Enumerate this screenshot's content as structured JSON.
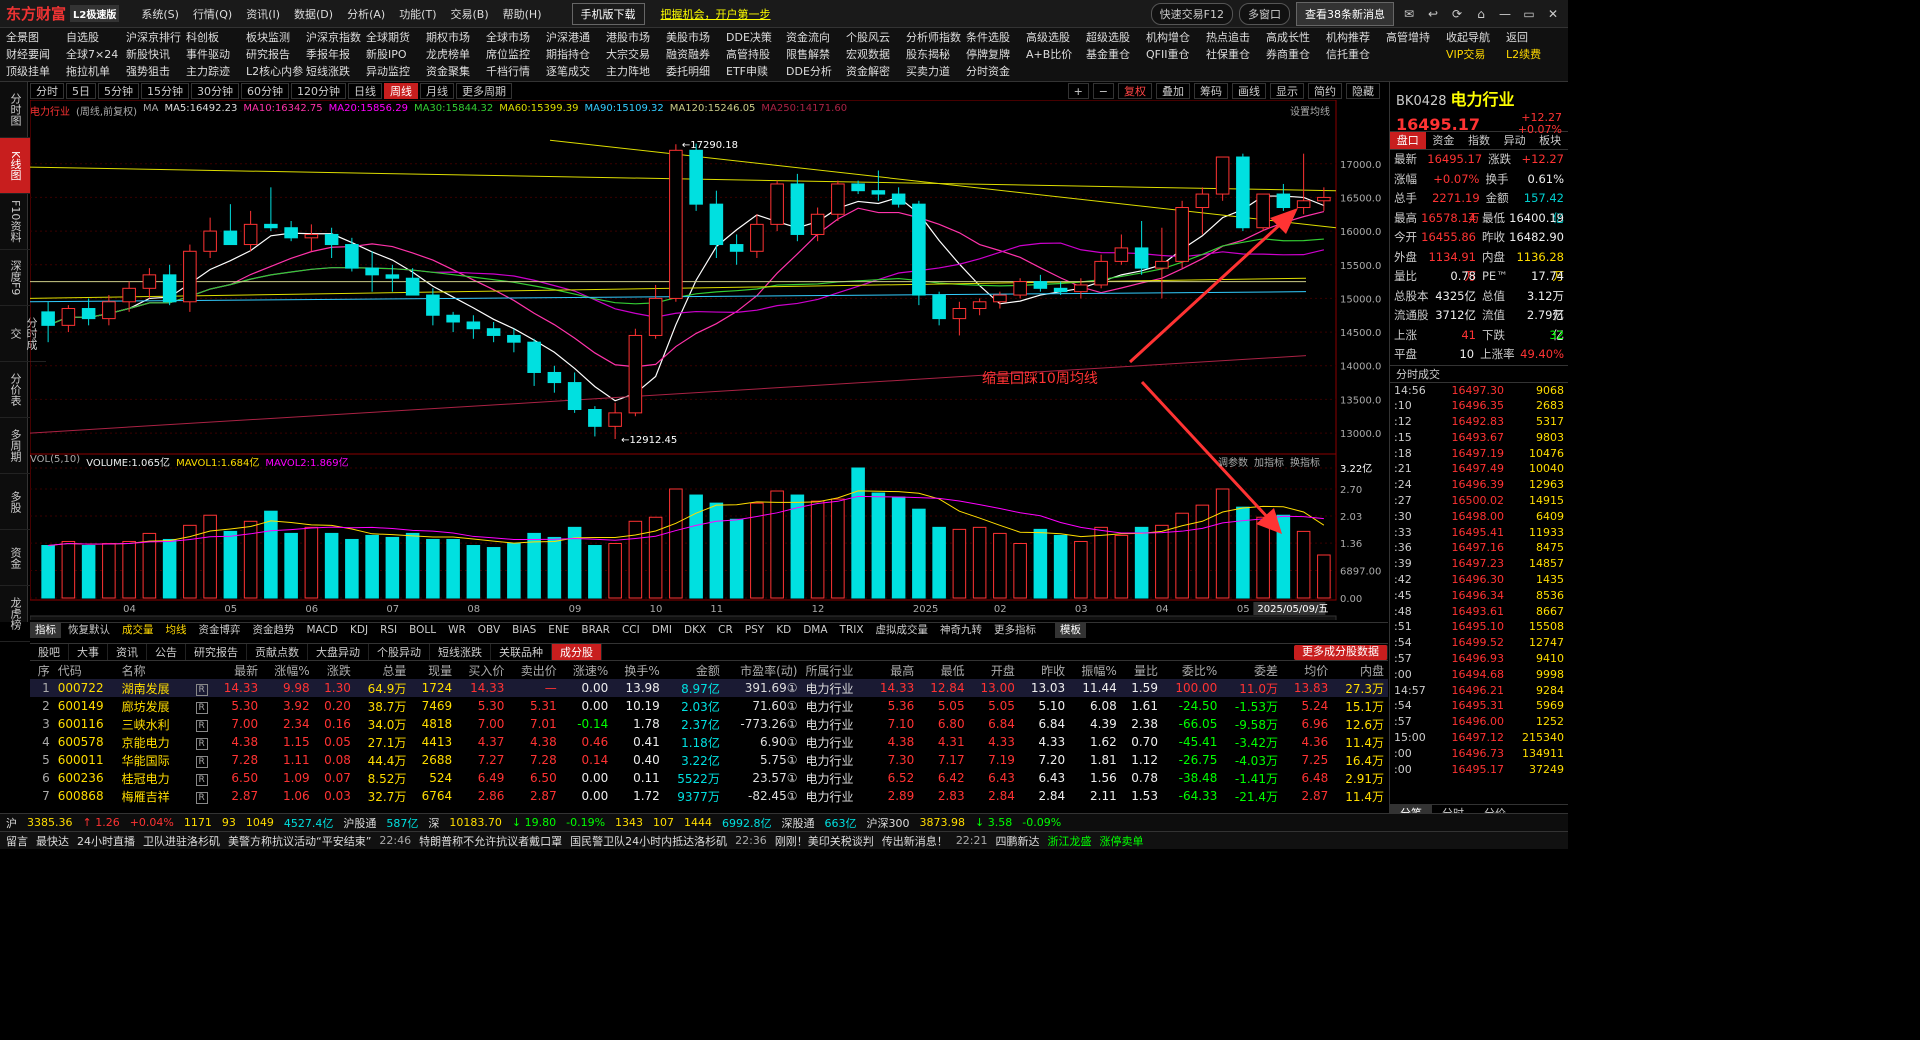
{
  "app": {
    "logo": "东方财富",
    "edition": "L2极速版"
  },
  "menu": [
    "系统(S)",
    "行情(Q)",
    "资讯(I)",
    "数据(D)",
    "分析(A)",
    "功能(T)",
    "交易(B)",
    "帮助(H)"
  ],
  "promo": {
    "mobile": "手机版下载",
    "opportunity": "把握机会，开户第一步"
  },
  "titlebar": {
    "search": "快速交易F12",
    "multi": "多窗口",
    "news": "查看38条新消息",
    "badge": "38"
  },
  "toolbar": [
    [
      "全景图",
      "自选股",
      "沪深京排行",
      "科创板",
      "板块监测",
      "沪深京指数",
      "全球期货",
      "期权市场",
      "全球市场",
      "沪深港通",
      "港股市场",
      "美股市场",
      "DDE决策",
      "资金流向",
      "个股风云",
      "分析师指数",
      "条件选股",
      "高级选股",
      "超级选股",
      "机构增仓",
      "热点追击",
      "高成长性",
      "机构推荐",
      "高管增持",
      "收起导航",
      "返回"
    ],
    [
      "财经要闻",
      "全球7×24",
      "新股快讯",
      "事件驱动",
      "研究报告",
      "季报年报",
      "新股IPO",
      "龙虎榜单",
      "席位监控",
      "期指持仓",
      "大宗交易",
      "融资融券",
      "高管持股",
      "限售解禁",
      "宏观数据",
      "股东揭秘",
      "停牌复牌",
      "A+B比价",
      "基金重仓",
      "QFII重仓",
      "社保重仓",
      "券商重仓",
      "信托重仓",
      "",
      "VIP交易",
      "L2续费"
    ],
    [
      "顶级挂单",
      "拖拉机单",
      "强势狙击",
      "主力踪迹",
      "L2核心内参",
      "短线涨跌",
      "异动监控",
      "资金聚集",
      "千档行情",
      "逐笔成交",
      "主力阵地",
      "委托明细",
      "ETF申赎",
      "DDE分析",
      "资金解密",
      "买卖力道",
      "分时资金",
      "",
      "",
      "",
      "",
      "",
      "",
      "",
      "",
      ""
    ]
  ],
  "leftnav": [
    "分时图",
    "K线图",
    "F10资料",
    "深度F9",
    "分时成交",
    "分价表",
    "多周期",
    "多股",
    "资金",
    "龙虎榜"
  ],
  "periods": [
    "分时",
    "5日",
    "5分钟",
    "15分钟",
    "30分钟",
    "60分钟",
    "120分钟",
    "日线",
    "周线",
    "月线",
    "更多周期"
  ],
  "period_active": "周线",
  "chart_tools": {
    "fq": "复权",
    "overlay": "叠加",
    "chips": "筹码",
    "draw": "画线",
    "display": "显示",
    "simple": "简约",
    "hide": "隐藏"
  },
  "ma_legend": {
    "name": "电力行业",
    "mode": "(周线,前复权)",
    "ma": "MA",
    "ma5": "MA5:16492.23",
    "ma10": "MA10:16342.75",
    "ma20": "MA20:15856.29",
    "ma30": "MA30:15844.32",
    "ma60": "MA60:15399.39",
    "ma90": "MA90:15109.32",
    "ma120": "MA120:15246.05",
    "ma250": "MA250:14171.60",
    "settings": "设置均线"
  },
  "vol_legend": {
    "title": "VOL(5,10)",
    "volume": "VOLUME:1.065亿",
    "mavol1": "MAVOL1:1.684亿",
    "mavol2": "MAVOL2:1.869亿",
    "params": "调参数",
    "add": "加指标",
    "switch": "换指标"
  },
  "annotation": "缩量回踩10周均线",
  "chart_data": {
    "type": "candlestick",
    "title": "电力行业",
    "price_ticks": [
      17000,
      16500,
      16000,
      15500,
      15000,
      14500,
      14000,
      13500,
      13000
    ],
    "price_ticks_text": [
      "17000.0",
      "16500.0",
      "16000.0",
      "15500.0",
      "15000.0",
      "14500.0",
      "14000.0",
      "13500.0",
      "13000.0"
    ],
    "ylim": [
      12600,
      17650
    ],
    "high_label": "17290.18",
    "low_label": "12912.45",
    "vol_ticks_text": [
      "3.22亿",
      "2.70",
      "2.03",
      "1.36",
      "6897.00",
      "0.00"
    ],
    "vol_max": 3.22,
    "x_labels": [
      "04",
      "05",
      "06",
      "07",
      "08",
      "09",
      "10",
      "11",
      "12",
      "2025",
      "02",
      "03",
      "04",
      "05",
      "06"
    ],
    "x_label_index": [
      4,
      9,
      13,
      17,
      21,
      26,
      30,
      33,
      38,
      43,
      47,
      51,
      55,
      59,
      61
    ],
    "date_tip": "2025/05/09/五",
    "candles": [
      [
        14800,
        14950,
        14350,
        14600
      ],
      [
        14600,
        14900,
        14500,
        14850
      ],
      [
        14850,
        15000,
        14600,
        14700
      ],
      [
        14700,
        15050,
        14600,
        14950
      ],
      [
        14950,
        15250,
        14800,
        15150
      ],
      [
        15150,
        15450,
        15000,
        15350
      ],
      [
        15350,
        15500,
        14900,
        14950
      ],
      [
        14950,
        15800,
        14800,
        15700
      ],
      [
        15700,
        16200,
        15600,
        16000
      ],
      [
        16000,
        16400,
        15800,
        15800
      ],
      [
        15800,
        16300,
        15700,
        16100
      ],
      [
        16100,
        16650,
        16000,
        16050
      ],
      [
        16050,
        16150,
        15850,
        15900
      ],
      [
        15900,
        16100,
        15700,
        15950
      ],
      [
        15950,
        16050,
        15600,
        15800
      ],
      [
        15800,
        15900,
        15400,
        15450
      ],
      [
        15450,
        15700,
        15100,
        15350
      ],
      [
        15350,
        15500,
        15100,
        15300
      ],
      [
        15300,
        15450,
        15050,
        15050
      ],
      [
        15050,
        15150,
        14600,
        14750
      ],
      [
        14750,
        14800,
        14500,
        14650
      ],
      [
        14650,
        14750,
        14400,
        14550
      ],
      [
        14550,
        14650,
        14350,
        14450
      ],
      [
        14450,
        14550,
        14200,
        14350
      ],
      [
        14350,
        14400,
        13700,
        13900
      ],
      [
        13900,
        14000,
        13600,
        13750
      ],
      [
        13750,
        13900,
        13300,
        13350
      ],
      [
        13350,
        13400,
        12950,
        13100
      ],
      [
        13100,
        13450,
        12912,
        13300
      ],
      [
        13300,
        14550,
        13250,
        14450
      ],
      [
        14450,
        15200,
        14400,
        15000
      ],
      [
        15000,
        17290,
        14950,
        17200
      ],
      [
        17200,
        17300,
        16300,
        16400
      ],
      [
        16400,
        16600,
        15600,
        15800
      ],
      [
        15800,
        15950,
        15500,
        15700
      ],
      [
        15700,
        16250,
        15600,
        16100
      ],
      [
        16100,
        16750,
        16000,
        16700
      ],
      [
        16700,
        16850,
        15850,
        15950
      ],
      [
        15950,
        16350,
        15850,
        16250
      ],
      [
        16250,
        16750,
        16150,
        16700
      ],
      [
        16700,
        16750,
        16550,
        16600
      ],
      [
        16600,
        16900,
        16450,
        16550
      ],
      [
        16550,
        16650,
        16350,
        16400
      ],
      [
        16400,
        16450,
        14900,
        15050
      ],
      [
        15050,
        15100,
        14600,
        14700
      ],
      [
        14700,
        14950,
        14450,
        14850
      ],
      [
        14850,
        15000,
        14750,
        14950
      ],
      [
        14950,
        15100,
        14850,
        15050
      ],
      [
        15050,
        15300,
        15000,
        15250
      ],
      [
        15250,
        15350,
        15100,
        15150
      ],
      [
        15150,
        15250,
        15050,
        15100
      ],
      [
        15100,
        15300,
        15000,
        15200
      ],
      [
        15200,
        15650,
        15150,
        15550
      ],
      [
        15550,
        15950,
        15500,
        15750
      ],
      [
        15750,
        16150,
        15350,
        15450
      ],
      [
        15450,
        16050,
        15000,
        15550
      ],
      [
        15550,
        16450,
        15450,
        16350
      ],
      [
        16350,
        16650,
        15950,
        16550
      ],
      [
        16550,
        16950,
        16450,
        17100
      ],
      [
        17100,
        17150,
        16000,
        16050
      ],
      [
        16050,
        16550,
        16000,
        16550
      ],
      [
        16550,
        16700,
        16300,
        16350
      ],
      [
        16350,
        17150,
        16250,
        16450
      ],
      [
        16450,
        16650,
        16300,
        16500
      ]
    ],
    "volumes": [
      1.3,
      1.4,
      1.3,
      1.35,
      1.4,
      1.6,
      1.45,
      1.8,
      2.05,
      1.65,
      1.9,
      2.15,
      1.6,
      1.75,
      1.6,
      1.45,
      1.55,
      1.5,
      1.6,
      1.45,
      1.45,
      1.3,
      1.25,
      1.35,
      1.6,
      1.5,
      1.75,
      1.3,
      1.35,
      1.9,
      2.0,
      2.7,
      2.55,
      2.35,
      1.95,
      2.35,
      2.65,
      2.55,
      2.4,
      2.45,
      3.22,
      2.6,
      2.5,
      2.2,
      1.75,
      1.7,
      1.75,
      1.6,
      1.35,
      1.7,
      1.55,
      1.4,
      1.75,
      1.55,
      1.75,
      1.8,
      2.1,
      2.3,
      2.7,
      2.25,
      2.0,
      2.05,
      1.65,
      1.065
    ]
  },
  "right": {
    "code": "BK0428",
    "name": "电力行业",
    "price": "16495.17",
    "chg": "+12.27",
    "pct": "+0.07%",
    "tabs": [
      "盘口",
      "资金",
      "指数",
      "异动",
      "板块"
    ],
    "quotes": [
      [
        "最新",
        "16495.17",
        "涨跌",
        "+12.27"
      ],
      [
        "涨幅",
        "+0.07%",
        "换手",
        "0.61%"
      ],
      [
        "总手",
        "2271.19万",
        "金额",
        "157.42亿"
      ],
      [
        "最高",
        "16578.14",
        "最低",
        "16400.19"
      ],
      [
        "今开",
        "16455.86",
        "昨收",
        "16482.90"
      ],
      [
        "外盘",
        "1134.91万",
        "内盘",
        "1136.28万"
      ],
      [
        "量比",
        "0.78",
        "PE™",
        "17.74"
      ],
      [
        "总股本",
        "4325亿",
        "总值",
        "3.12万亿"
      ],
      [
        "流通股",
        "3712亿",
        "流值",
        "2.79万亿"
      ],
      [
        "上涨",
        "41",
        "下跌",
        "32"
      ],
      [
        "平盘",
        "10",
        "上涨率",
        "49.40%"
      ]
    ],
    "ticks_title": "分时成交",
    "ticks": [
      [
        "14:56",
        "16497.30",
        "9068",
        "g"
      ],
      [
        ":10",
        "16496.35",
        "2683",
        "r"
      ],
      [
        ":12",
        "16492.83",
        "5317",
        "r"
      ],
      [
        ":15",
        "16493.67",
        "9803",
        "r"
      ],
      [
        ":18",
        "16497.19",
        "10476",
        "r"
      ],
      [
        ":21",
        "16497.49",
        "10040",
        "r"
      ],
      [
        ":24",
        "16496.39",
        "12963",
        "r"
      ],
      [
        ":27",
        "16500.02",
        "14915",
        "r"
      ],
      [
        ":30",
        "16498.00",
        "6409",
        "r"
      ],
      [
        ":33",
        "16495.41",
        "11933",
        "r"
      ],
      [
        ":36",
        "16497.16",
        "8475",
        "r"
      ],
      [
        ":39",
        "16497.23",
        "14857",
        "r"
      ],
      [
        ":42",
        "16496.30",
        "1435",
        "r"
      ],
      [
        ":45",
        "16496.34",
        "8536",
        "r"
      ],
      [
        ":48",
        "16493.61",
        "8667",
        "r"
      ],
      [
        ":51",
        "16495.10",
        "15508",
        "r"
      ],
      [
        ":54",
        "16499.52",
        "12747",
        "r"
      ],
      [
        ":57",
        "16496.93",
        "9410",
        "r"
      ],
      [
        ":00",
        "16494.68",
        "9998",
        "r"
      ],
      [
        "14:57",
        "16496.21",
        "9284",
        "r"
      ],
      [
        ":54",
        "16495.31",
        "5969",
        "r"
      ],
      [
        ":57",
        "16496.00",
        "1252",
        "r"
      ],
      [
        "15:00",
        "16497.12",
        "215340",
        "r"
      ],
      [
        ":00",
        "16496.73",
        "134911",
        "r"
      ],
      [
        ":00",
        "16495.17",
        "37249",
        "r"
      ]
    ],
    "btabs": [
      "分笔",
      "分时",
      "分价"
    ]
  },
  "indicators": [
    "指标",
    "恢复默认",
    "成交量",
    "均线",
    "资金博弈",
    "资金趋势",
    "MACD",
    "KDJ",
    "RSI",
    "BOLL",
    "WR",
    "OBV",
    "BIAS",
    "ENE",
    "BRAR",
    "CCI",
    "DMI",
    "DKX",
    "CR",
    "PSY",
    "KD",
    "DMA",
    "TRIX",
    "虚拟成交量",
    "神奇九转",
    "更多指标",
    "",
    "模板"
  ],
  "tabs2": [
    "股吧",
    "大事",
    "资讯",
    "公告",
    "研究报告",
    "贡献点数",
    "大盘异动",
    "个股异动",
    "短线涨跌",
    "关联品种",
    "成分股"
  ],
  "tabs2_more": "更多成分股数据",
  "table": {
    "headers": [
      "序",
      "代码",
      "名称",
      "",
      "最新",
      "涨幅%",
      "涨跌",
      "总量",
      "现量",
      "买入价",
      "卖出价",
      "涨速%",
      "换手%",
      "金额",
      "市盈率(动)",
      "所属行业",
      "最高",
      "最低",
      "开盘",
      "昨收",
      "振幅%",
      "量比",
      "委比%",
      "委差",
      "均价",
      "内盘"
    ],
    "rows": [
      [
        "1",
        "000722",
        "湖南发展",
        "R",
        "14.33",
        "9.98",
        "1.30",
        "64.9万",
        "1724",
        "14.33",
        "—",
        "0.00",
        "13.98",
        "8.97亿",
        "391.69①",
        "电力行业",
        "14.33",
        "12.84",
        "13.00",
        "13.03",
        "11.44",
        "1.59",
        "100.00",
        "11.0万",
        "13.83",
        "27.3万"
      ],
      [
        "2",
        "600149",
        "廊坊发展",
        "R",
        "5.30",
        "3.92",
        "0.20",
        "38.7万",
        "7469",
        "5.30",
        "5.31",
        "0.00",
        "10.19",
        "2.03亿",
        "71.60①",
        "电力行业",
        "5.36",
        "5.05",
        "5.05",
        "5.10",
        "6.08",
        "1.61",
        "-24.50",
        "-1.53万",
        "5.24",
        "15.1万"
      ],
      [
        "3",
        "600116",
        "三峡水利",
        "R",
        "7.00",
        "2.34",
        "0.16",
        "34.0万",
        "4818",
        "7.00",
        "7.01",
        "-0.14",
        "1.78",
        "2.37亿",
        "-773.26①",
        "电力行业",
        "7.10",
        "6.80",
        "6.84",
        "6.84",
        "4.39",
        "2.38",
        "-66.05",
        "-9.58万",
        "6.96",
        "12.6万"
      ],
      [
        "4",
        "600578",
        "京能电力",
        "R",
        "4.38",
        "1.15",
        "0.05",
        "27.1万",
        "4413",
        "4.37",
        "4.38",
        "0.46",
        "0.41",
        "1.18亿",
        "6.90①",
        "电力行业",
        "4.38",
        "4.31",
        "4.33",
        "4.33",
        "1.62",
        "0.70",
        "-45.41",
        "-3.42万",
        "4.36",
        "11.4万"
      ],
      [
        "5",
        "600011",
        "华能国际",
        "R",
        "7.28",
        "1.11",
        "0.08",
        "44.4万",
        "2688",
        "7.27",
        "7.28",
        "0.14",
        "0.40",
        "3.22亿",
        "5.75①",
        "电力行业",
        "7.30",
        "7.17",
        "7.19",
        "7.20",
        "1.81",
        "1.12",
        "-26.75",
        "-4.03万",
        "7.25",
        "16.4万"
      ],
      [
        "6",
        "600236",
        "桂冠电力",
        "R",
        "6.50",
        "1.09",
        "0.07",
        "8.52万",
        "524",
        "6.49",
        "6.50",
        "0.00",
        "0.11",
        "5522万",
        "23.57①",
        "电力行业",
        "6.52",
        "6.42",
        "6.43",
        "6.43",
        "1.56",
        "0.78",
        "-38.48",
        "-1.41万",
        "6.48",
        "2.91万"
      ],
      [
        "7",
        "600868",
        "梅雁吉祥",
        "R",
        "2.87",
        "1.06",
        "0.03",
        "32.7万",
        "6764",
        "2.86",
        "2.87",
        "0.00",
        "1.72",
        "9377万",
        "-82.45①",
        "电力行业",
        "2.89",
        "2.83",
        "2.84",
        "2.84",
        "2.11",
        "1.53",
        "-64.33",
        "-21.4万",
        "2.87",
        "11.4万"
      ]
    ]
  },
  "status": [
    "沪",
    "3385.36",
    "↑ 1.26",
    "+0.04%",
    "1171",
    "93",
    "1049",
    "4527.4亿",
    "沪股通",
    "587亿",
    "深",
    "10183.70",
    "↓ 19.80",
    "-0.19%",
    "1343",
    "107",
    "1444",
    "6992.8亿",
    "深股通",
    "663亿",
    "沪深300",
    "3873.98",
    "↓ 3.58",
    "-0.09%"
  ],
  "news": [
    "留言",
    "最快达",
    "24小时直播",
    "卫队进驻洛杉矶",
    "美警方称抗议活动“平安结束”",
    "22:46",
    "特朗普称不允许抗议者戴口罩",
    "国民警卫队24小时内抵达洛杉矶",
    "22:36",
    "刚刚！美印关税谈判",
    "传出新消息！",
    "22:21",
    "四鹏新达",
    "浙江龙盛",
    "涨停卖单"
  ]
}
